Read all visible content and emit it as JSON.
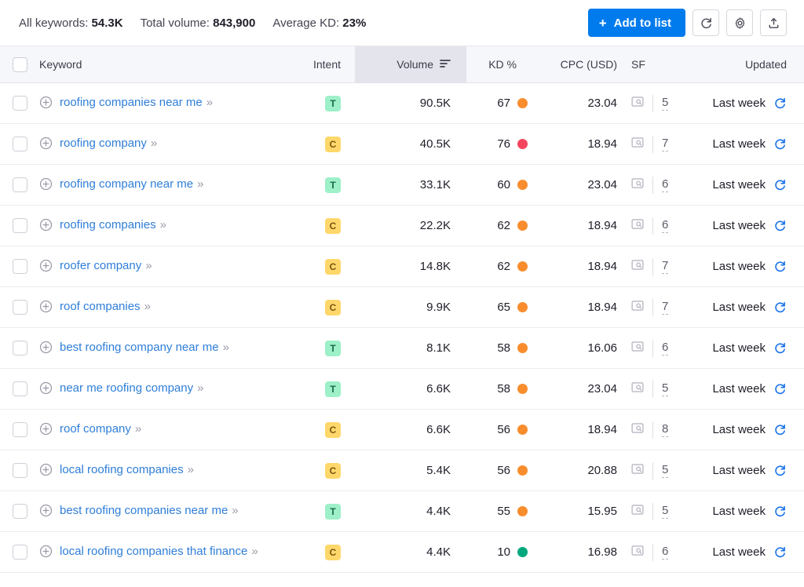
{
  "summary": {
    "all_keywords_label": "All keywords:",
    "all_keywords_value": "54.3K",
    "total_volume_label": "Total volume:",
    "total_volume_value": "843,900",
    "average_kd_label": "Average KD:",
    "average_kd_value": "23%"
  },
  "actions": {
    "add_to_list": "Add to list",
    "plus": "+",
    "refresh_icon": "refresh-icon",
    "settings_icon": "gear-icon",
    "export_icon": "export-icon"
  },
  "table": {
    "columns": {
      "keyword": "Keyword",
      "intent": "Intent",
      "volume": "Volume",
      "kd": "KD %",
      "cpc": "CPC (USD)",
      "sf": "SF",
      "updated": "Updated"
    },
    "sorted_column": "Volume",
    "sort_icon": "sort-descending-icon",
    "colors": {
      "kd_green": "#00a87e",
      "kd_orange": "#f98d2d",
      "kd_red": "#f5455f",
      "accent_blue": "#007bed",
      "link_blue": "#2f7ed8",
      "sorted_header_bg": "#e4e4ed"
    },
    "rows": [
      {
        "keyword": "roofing companies near me",
        "intent": "T",
        "volume": "90.5K",
        "kd": "67",
        "kd_color": "orange",
        "cpc": "23.04",
        "sf": "5",
        "updated": "Last week"
      },
      {
        "keyword": "roofing company",
        "intent": "C",
        "volume": "40.5K",
        "kd": "76",
        "kd_color": "red",
        "cpc": "18.94",
        "sf": "7",
        "updated": "Last week"
      },
      {
        "keyword": "roofing company near me",
        "intent": "T",
        "volume": "33.1K",
        "kd": "60",
        "kd_color": "orange",
        "cpc": "23.04",
        "sf": "6",
        "updated": "Last week"
      },
      {
        "keyword": "roofing companies",
        "intent": "C",
        "volume": "22.2K",
        "kd": "62",
        "kd_color": "orange",
        "cpc": "18.94",
        "sf": "6",
        "updated": "Last week"
      },
      {
        "keyword": "roofer company",
        "intent": "C",
        "volume": "14.8K",
        "kd": "62",
        "kd_color": "orange",
        "cpc": "18.94",
        "sf": "7",
        "updated": "Last week"
      },
      {
        "keyword": "roof companies",
        "intent": "C",
        "volume": "9.9K",
        "kd": "65",
        "kd_color": "orange",
        "cpc": "18.94",
        "sf": "7",
        "updated": "Last week"
      },
      {
        "keyword": "best roofing company near me",
        "intent": "T",
        "volume": "8.1K",
        "kd": "58",
        "kd_color": "orange",
        "cpc": "16.06",
        "sf": "6",
        "updated": "Last week"
      },
      {
        "keyword": "near me roofing company",
        "intent": "T",
        "volume": "6.6K",
        "kd": "58",
        "kd_color": "orange",
        "cpc": "23.04",
        "sf": "5",
        "updated": "Last week"
      },
      {
        "keyword": "roof company",
        "intent": "C",
        "volume": "6.6K",
        "kd": "56",
        "kd_color": "orange",
        "cpc": "18.94",
        "sf": "8",
        "updated": "Last week"
      },
      {
        "keyword": "local roofing companies",
        "intent": "C",
        "volume": "5.4K",
        "kd": "56",
        "kd_color": "orange",
        "cpc": "20.88",
        "sf": "5",
        "updated": "Last week"
      },
      {
        "keyword": "best roofing companies near me",
        "intent": "T",
        "volume": "4.4K",
        "kd": "55",
        "kd_color": "orange",
        "cpc": "15.95",
        "sf": "5",
        "updated": "Last week"
      },
      {
        "keyword": "local roofing companies that finance",
        "intent": "C",
        "volume": "4.4K",
        "kd": "10",
        "kd_color": "green",
        "cpc": "16.98",
        "sf": "6",
        "updated": "Last week"
      }
    ]
  }
}
